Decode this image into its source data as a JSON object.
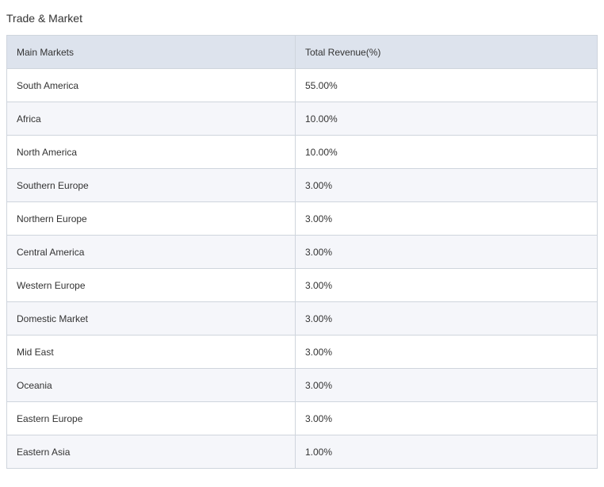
{
  "section": {
    "title": "Trade & Market"
  },
  "table": {
    "headers": [
      "Main Markets",
      "Total Revenue(%)"
    ],
    "rows": [
      [
        "South America",
        "55.00%"
      ],
      [
        "Africa",
        "10.00%"
      ],
      [
        "North America",
        "10.00%"
      ],
      [
        "Southern Europe",
        "3.00%"
      ],
      [
        "Northern Europe",
        "3.00%"
      ],
      [
        "Central America",
        "3.00%"
      ],
      [
        "Western Europe",
        "3.00%"
      ],
      [
        "Domestic Market",
        "3.00%"
      ],
      [
        "Mid East",
        "3.00%"
      ],
      [
        "Oceania",
        "3.00%"
      ],
      [
        "Eastern Europe",
        "3.00%"
      ],
      [
        "Eastern Asia",
        "1.00%"
      ]
    ]
  },
  "colors": {
    "header_bg": "#dde3ed",
    "row_alt_bg": "#f5f6fa",
    "border": "#cfd5dd",
    "text": "#333333"
  }
}
